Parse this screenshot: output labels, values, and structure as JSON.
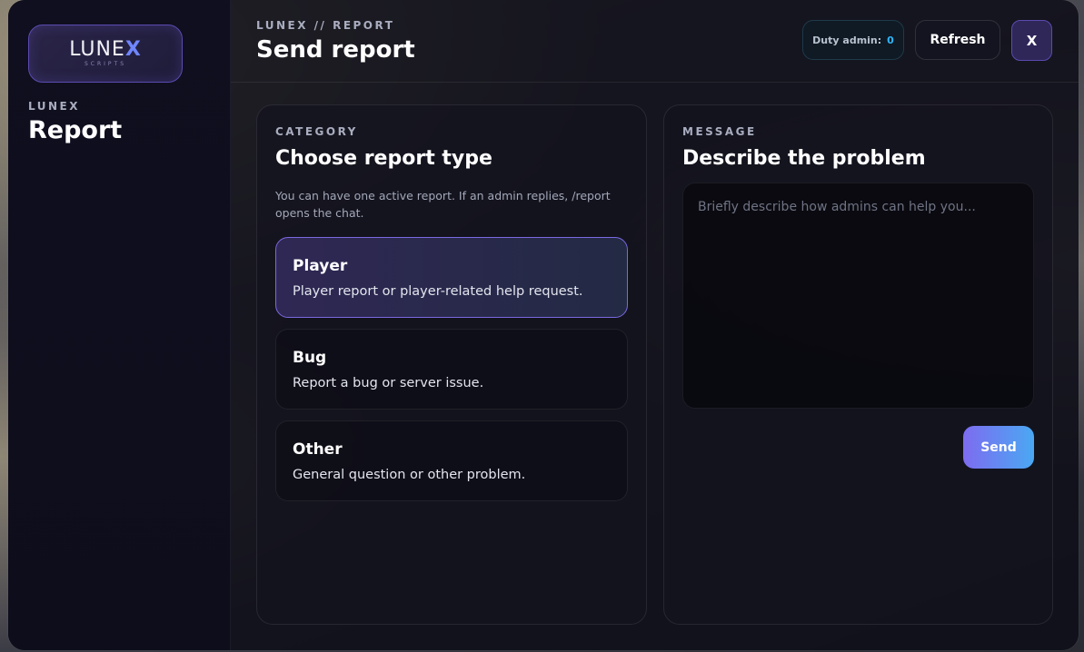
{
  "sidebar": {
    "logo": {
      "word": "LUNE",
      "accent": "X",
      "sub": "SCRIPTS"
    },
    "eyebrow": "LUNEX",
    "title": "Report"
  },
  "header": {
    "eyebrow": "LUNEX // REPORT",
    "title": "Send report",
    "duty_label": "Duty admin:",
    "duty_count": "0",
    "refresh_label": "Refresh",
    "close_label": "X"
  },
  "category": {
    "eyebrow": "CATEGORY",
    "title": "Choose report type",
    "description": "You can have one active report. If an admin replies, /report opens the chat.",
    "options": [
      {
        "title": "Player",
        "description": "Player report or player-related help request.",
        "selected": true
      },
      {
        "title": "Bug",
        "description": "Report a bug or server issue.",
        "selected": false
      },
      {
        "title": "Other",
        "description": "General question or other problem.",
        "selected": false
      }
    ]
  },
  "message": {
    "eyebrow": "MESSAGE",
    "title": "Describe the problem",
    "value": "",
    "placeholder": "Briefly describe how admins can help you...",
    "send_label": "Send"
  },
  "colors": {
    "accent": "#7b68e0",
    "accent_gradient_end": "#4aa8f3",
    "duty_count": "#2fb6ff",
    "panel_bg": "#14141e"
  }
}
